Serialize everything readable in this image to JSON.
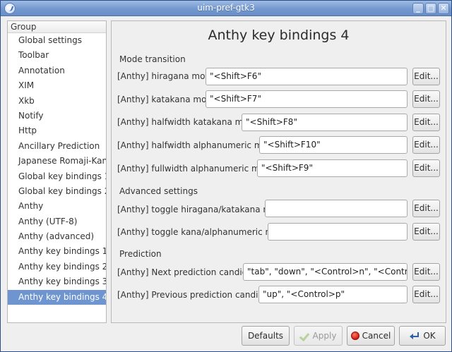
{
  "window": {
    "title": "uim-pref-gtk3",
    "buttons": {
      "minimize": "_",
      "maximize": "□",
      "close": "✕"
    }
  },
  "sidebar": {
    "header": "Group",
    "items": [
      {
        "label": "Global settings"
      },
      {
        "label": "Toolbar"
      },
      {
        "label": "Annotation"
      },
      {
        "label": "XIM"
      },
      {
        "label": "Xkb"
      },
      {
        "label": "Notify"
      },
      {
        "label": "Http"
      },
      {
        "label": "Ancillary Prediction"
      },
      {
        "label": "Japanese Romaji-Kana"
      },
      {
        "label": "Global key bindings 1"
      },
      {
        "label": "Global key bindings 2"
      },
      {
        "label": "Anthy"
      },
      {
        "label": "Anthy (UTF-8)"
      },
      {
        "label": "Anthy (advanced)"
      },
      {
        "label": "Anthy key bindings 1"
      },
      {
        "label": "Anthy key bindings 2"
      },
      {
        "label": "Anthy key bindings 3"
      },
      {
        "label": "Anthy key bindings 4"
      }
    ],
    "selected": "Anthy key bindings 4"
  },
  "panel": {
    "title": "Anthy key bindings 4",
    "edit_label": "Edit...",
    "sections": {
      "mode_transition": "Mode transition",
      "advanced": "Advanced settings",
      "prediction": "Prediction"
    },
    "rows": [
      {
        "label": "[Anthy] hiragana mode",
        "value": "\"<Shift>F6\""
      },
      {
        "label": "[Anthy] katakana mode",
        "value": "\"<Shift>F7\""
      },
      {
        "label": "[Anthy] halfwidth katakana mode",
        "value": "\"<Shift>F8\""
      },
      {
        "label": "[Anthy] halfwidth alphanumeric mode",
        "value": "\"<Shift>F10\""
      },
      {
        "label": "[Anthy] fullwidth alphanumeric mode",
        "value": "\"<Shift>F9\""
      },
      {
        "label": "[Anthy] toggle hiragana/katakana mode",
        "value": ""
      },
      {
        "label": "[Anthy] toggle kana/alphanumeric mode",
        "value": ""
      },
      {
        "label": "[Anthy] Next prediction candidate",
        "value": "\"tab\", \"down\", \"<Control>n\", \"<Control>i\""
      },
      {
        "label": "[Anthy] Previous prediction candidate",
        "value": "\"up\", \"<Control>p\""
      }
    ]
  },
  "footer": {
    "defaults": "Defaults",
    "apply": "Apply",
    "cancel": "Cancel",
    "ok": "OK"
  },
  "colors": {
    "titlebar": "#7398cf",
    "selection": "#6f95d1",
    "cancel_icon": "#d21a0c",
    "apply_icon": "#b9d19b"
  }
}
